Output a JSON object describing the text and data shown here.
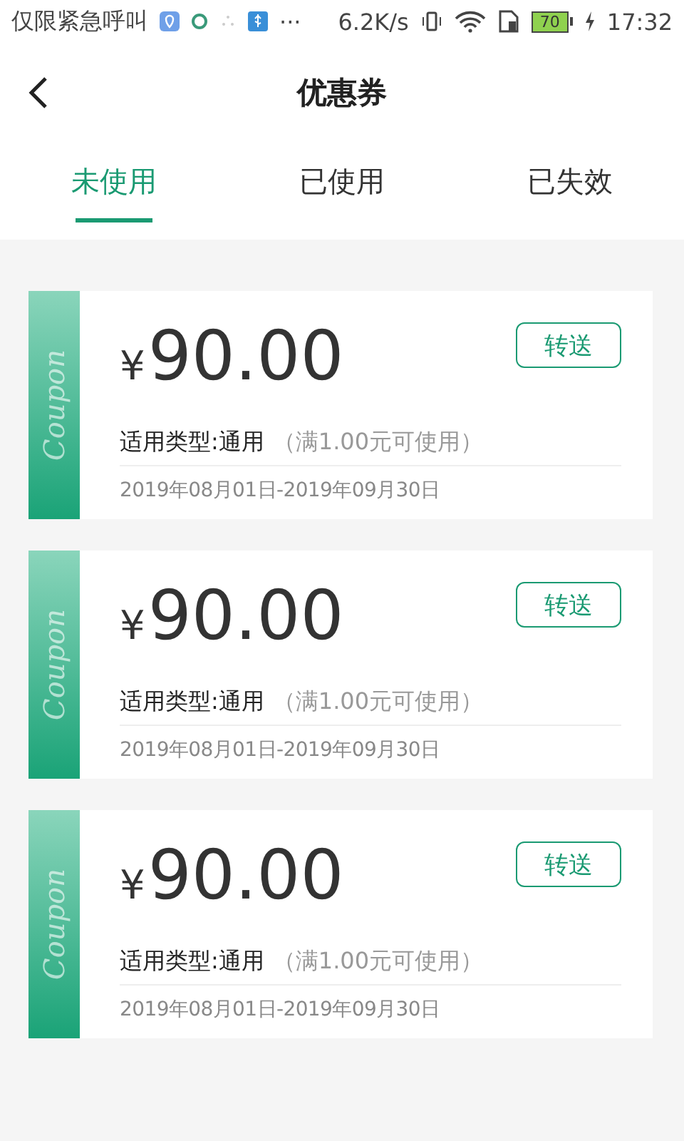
{
  "status_bar": {
    "carrier": "仅限紧急呼叫",
    "more": "···",
    "speed": "6.2K/s",
    "battery": "70",
    "time": "17:32"
  },
  "header": {
    "title": "优惠券"
  },
  "tabs": [
    {
      "label": "未使用",
      "selected": true
    },
    {
      "label": "已使用",
      "selected": false
    },
    {
      "label": "已失效",
      "selected": false
    }
  ],
  "coupons": [
    {
      "currency": "¥",
      "amount": "90.00",
      "stub_text": "Coupon",
      "action": "转送",
      "type": "适用类型:通用",
      "condition": "（满1.00元可使用）",
      "validity": "2019年08月01日-2019年09月30日"
    },
    {
      "currency": "¥",
      "amount": "90.00",
      "stub_text": "Coupon",
      "action": "转送",
      "type": "适用类型:通用",
      "condition": "（满1.00元可使用）",
      "validity": "2019年08月01日-2019年09月30日"
    },
    {
      "currency": "¥",
      "amount": "90.00",
      "stub_text": "Coupon",
      "action": "转送",
      "type": "适用类型:通用",
      "condition": "（满1.00元可使用）",
      "validity": "2019年08月01日-2019年09月30日"
    }
  ]
}
